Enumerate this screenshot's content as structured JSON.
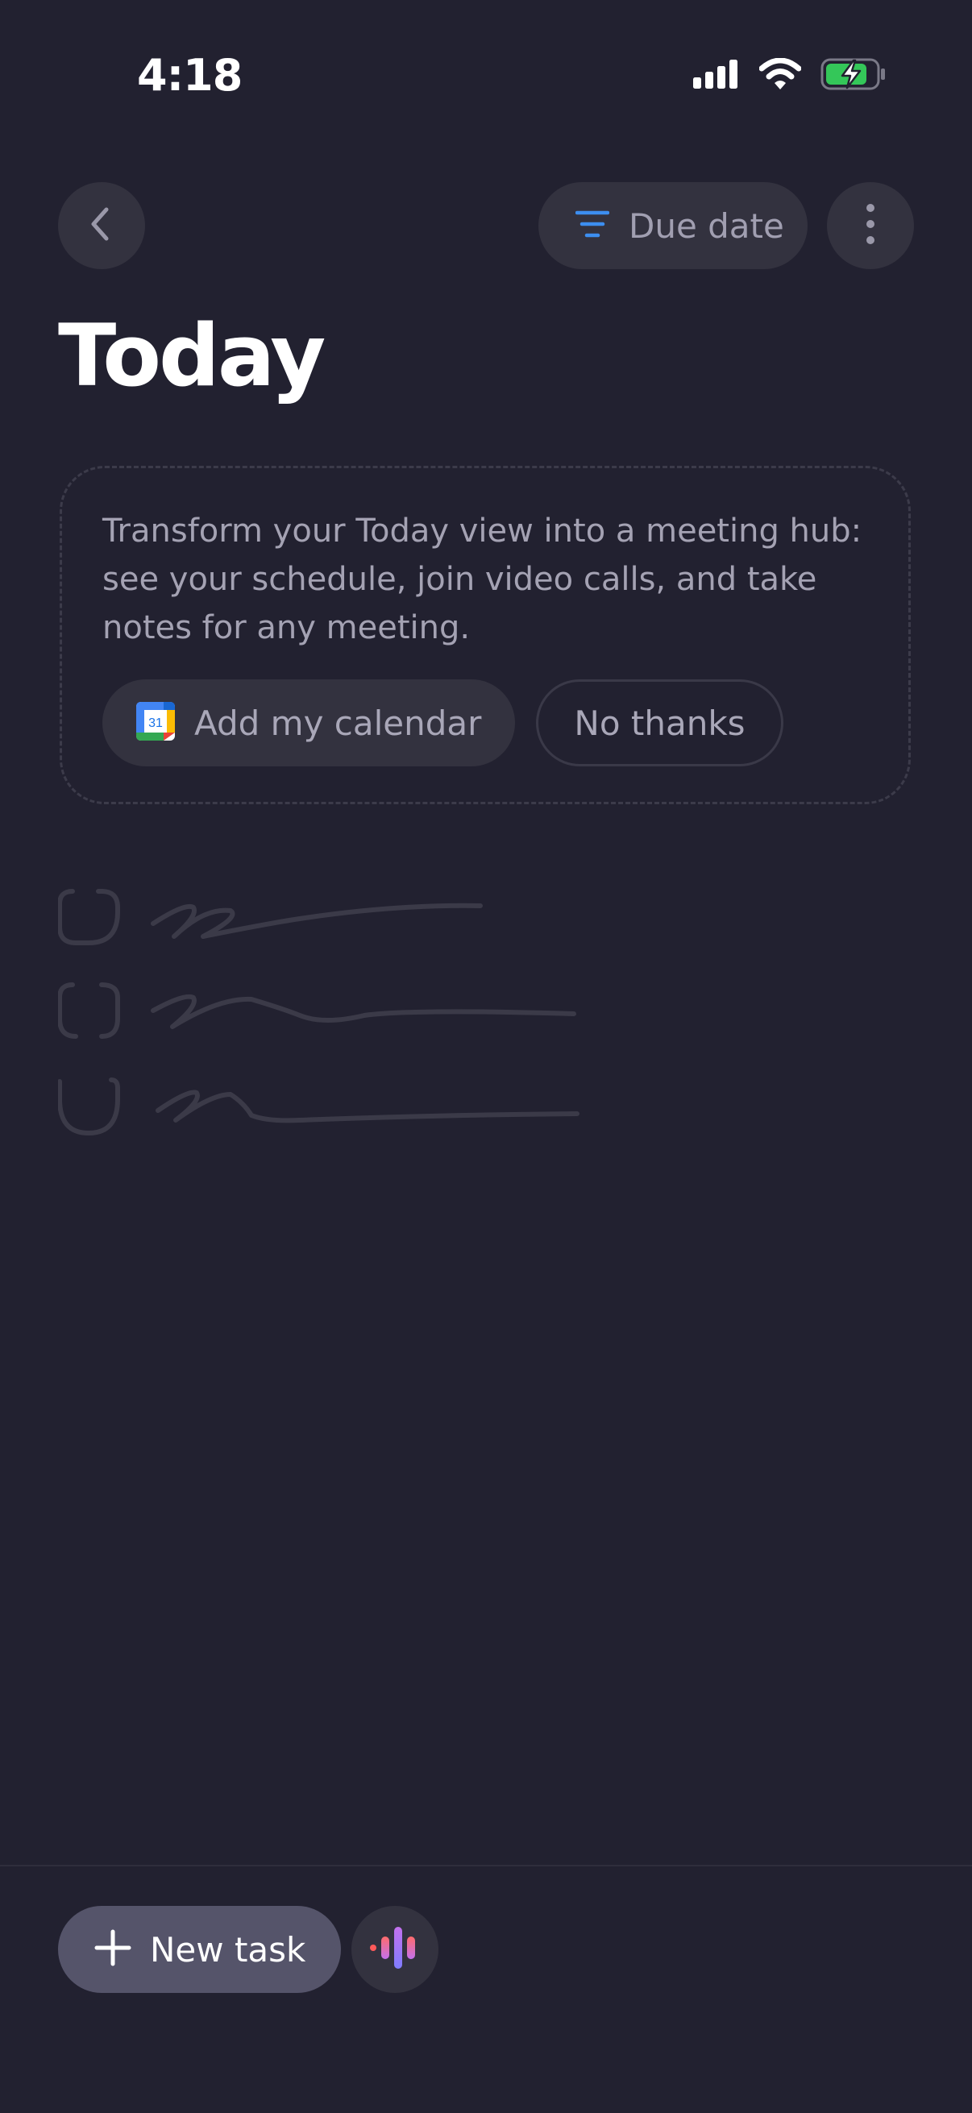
{
  "status_bar": {
    "time": "4:18"
  },
  "header": {
    "sort_label": "Due date"
  },
  "page": {
    "title": "Today"
  },
  "promo": {
    "text": "Transform your Today view into a meeting hub: see your schedule, join video calls, and take notes for any meeting.",
    "calendar_icon_day": "31",
    "add_calendar_label": "Add my calendar",
    "no_thanks_label": "No thanks"
  },
  "bottom_bar": {
    "new_task_label": "New task"
  },
  "colors": {
    "background": "#222130",
    "surface": "#33323f",
    "accent_blue": "#3d8ef0",
    "battery_green": "#34c759",
    "new_task_bg": "#55546a"
  },
  "icons": {
    "back": "chevron-left-icon",
    "sort": "filter-lines-icon",
    "more": "vertical-dots-icon",
    "calendar": "google-calendar-icon",
    "add": "plus-icon",
    "voice": "voice-waveform-icon"
  }
}
